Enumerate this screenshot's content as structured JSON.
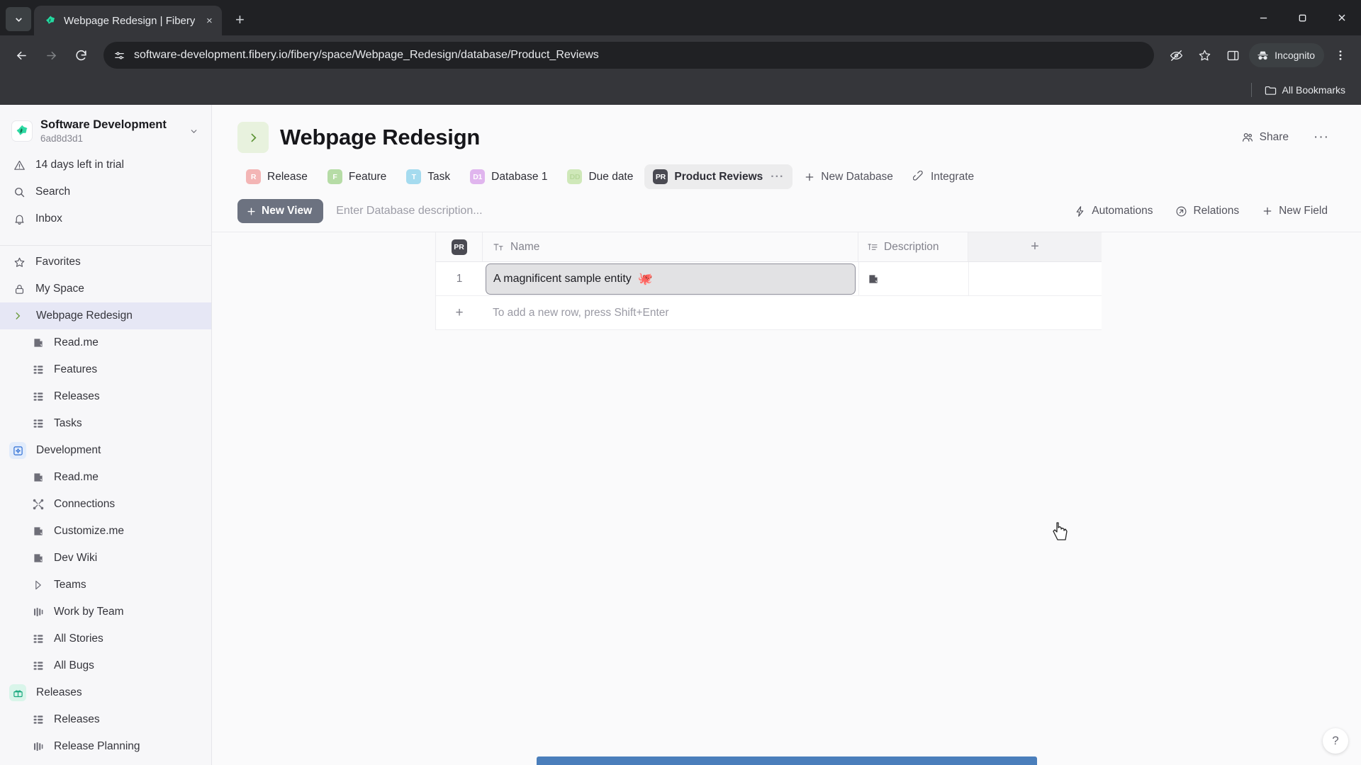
{
  "browser": {
    "tab": {
      "title": "Webpage Redesign | Fibery",
      "favicon": "fibery-logo-icon",
      "close": "×"
    },
    "new_tab_label": "+",
    "tab_search_icon": "chevron-down-icon",
    "window": {
      "minimize": "–",
      "maximize": "□",
      "close": "✕"
    },
    "nav": {
      "back": "←",
      "forward": "→",
      "reload": "⟳"
    },
    "omnibox": {
      "site_icon": "site-settings-icon",
      "url": "software-development.fibery.io/fibery/space/Webpage_Redesign/database/Product_Reviews"
    },
    "toolbar_icons": [
      "eye-off-icon",
      "bookmark-star-icon",
      "side-panel-icon"
    ],
    "incognito_label": "Incognito",
    "menu_icon": "kebab-menu-icon",
    "bookmarks_bar": {
      "all_bookmarks_label": "All Bookmarks",
      "folder_icon": "folder-icon"
    }
  },
  "sidebar": {
    "workspace": {
      "name": "Software Development",
      "id": "6ad8d3d1",
      "chevron": "chevron-down-icon"
    },
    "top_items": [
      {
        "label": "14 days left in trial",
        "icon": "warning-triangle-icon"
      },
      {
        "label": "Search",
        "icon": "search-icon"
      },
      {
        "label": "Inbox",
        "icon": "bell-icon"
      }
    ],
    "nav_items": [
      {
        "label": "Favorites",
        "icon": "star-icon"
      },
      {
        "label": "My Space",
        "icon": "lock-icon"
      }
    ],
    "spaces": [
      {
        "label": "Webpage Redesign",
        "icon": "chevron-right-icon",
        "selected": true,
        "children": [
          {
            "label": "Read.me",
            "icon": "document-icon"
          },
          {
            "label": "Features",
            "icon": "grid-icon"
          },
          {
            "label": "Releases",
            "icon": "grid-icon"
          },
          {
            "label": "Tasks",
            "icon": "grid-icon"
          }
        ]
      },
      {
        "label": "Development",
        "icon": "puzzle-icon",
        "selected": false,
        "children": [
          {
            "label": "Read.me",
            "icon": "document-icon"
          },
          {
            "label": "Connections",
            "icon": "connections-icon"
          },
          {
            "label": "Customize.me",
            "icon": "document-icon"
          },
          {
            "label": "Dev Wiki",
            "icon": "document-icon"
          },
          {
            "label": "Teams",
            "icon": "play-outline-icon"
          },
          {
            "label": "Work by Team",
            "icon": "board-icon"
          },
          {
            "label": "All Stories",
            "icon": "grid-icon"
          },
          {
            "label": "All Bugs",
            "icon": "grid-icon"
          }
        ]
      },
      {
        "label": "Releases",
        "icon": "gift-icon",
        "selected": false,
        "children": [
          {
            "label": "Releases",
            "icon": "grid-icon"
          },
          {
            "label": "Release Planning",
            "icon": "board-icon"
          }
        ]
      }
    ]
  },
  "main": {
    "title": "Webpage Redesign",
    "title_chevron": "chevron-right-icon",
    "share_label": "Share",
    "share_icon": "people-icon",
    "more_label": "···",
    "database_tabs": [
      {
        "label": "Release",
        "badge": "R",
        "badge_color": "#f3b5b5",
        "active": false
      },
      {
        "label": "Feature",
        "badge": "F",
        "badge_color": "#b6dca6",
        "active": false
      },
      {
        "label": "Task",
        "badge": "T",
        "badge_color": "#a5dbef",
        "active": false
      },
      {
        "label": "Database 1",
        "badge": "D1",
        "badge_color": "#e0b5ee",
        "active": false
      },
      {
        "label": "Due date",
        "badge": "DD",
        "badge_color": "#cfe8b9",
        "active": false
      },
      {
        "label": "Product Reviews",
        "badge": "PR",
        "badge_color": "#4a4a52",
        "active": true
      }
    ],
    "tab_more": "···",
    "db_actions": [
      {
        "label": "New Database",
        "icon": "plus-icon"
      },
      {
        "label": "Integrate",
        "icon": "integrate-icon"
      }
    ],
    "view_bar": {
      "new_view_label": "New View",
      "new_view_icon": "plus-icon",
      "description_placeholder": "Enter Database description...",
      "actions": [
        {
          "label": "Automations",
          "icon": "lightning-icon"
        },
        {
          "label": "Relations",
          "icon": "relations-icon"
        },
        {
          "label": "New Field",
          "icon": "plus-icon"
        }
      ]
    },
    "table": {
      "row_badge": "PR",
      "columns": [
        {
          "label": "Name",
          "icon": "text-type-icon"
        },
        {
          "label": "Description",
          "icon": "rich-text-icon"
        }
      ],
      "add_column_label": "+",
      "rows": [
        {
          "index": "1",
          "name": "A magnificent sample entity",
          "name_emoji": "🐙",
          "description_icon": "document-icon"
        }
      ],
      "add_row_hint": "To add a new row, press Shift+Enter",
      "add_row_icon": "+"
    },
    "help_label": "?"
  },
  "colors": {
    "accent_green": "#5b9333",
    "selected_space": "#e6e7f5",
    "new_view_bg": "#6c7280",
    "toast_blue": "#4a7ebb"
  }
}
